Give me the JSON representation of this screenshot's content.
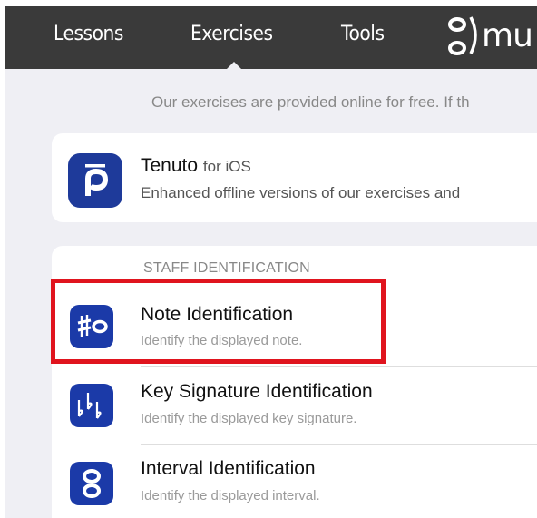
{
  "nav": {
    "items": [
      "Lessons",
      "Exercises",
      "Tools"
    ],
    "active": "Exercises",
    "logo_text": "mu"
  },
  "intro": "Our exercises are provided online for free. If th",
  "tenuto": {
    "title": "Tenuto",
    "subtitle": "for iOS",
    "description": "Enhanced offline versions of our exercises and"
  },
  "section": {
    "header": "STAFF IDENTIFICATION",
    "items": [
      {
        "title": "Note Identification",
        "description": "Identify the displayed note.",
        "icon": "sharp-note-icon"
      },
      {
        "title": "Key Signature Identification",
        "description": "Identify the displayed key signature.",
        "icon": "flats-icon"
      },
      {
        "title": "Interval Identification",
        "description": "Identify the displayed interval.",
        "icon": "interval-icon"
      }
    ]
  },
  "colors": {
    "nav_bg": "#3a3a3a",
    "icon_blue": "#1b3aa8",
    "highlight": "#e0141e",
    "page_bg": "#efeff4"
  }
}
